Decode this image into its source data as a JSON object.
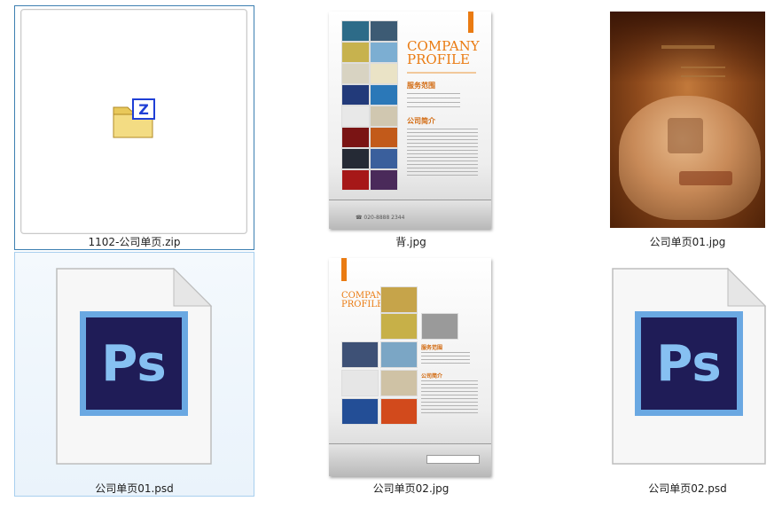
{
  "files": [
    {
      "id": "zip",
      "name": "1102-公司单页.zip",
      "type": "zip",
      "state": "selected",
      "icon": "zip-archive-icon"
    },
    {
      "id": "bg",
      "name": "背.jpg",
      "type": "jpg",
      "state": "normal",
      "preview": {
        "title_line1": "COMPANY",
        "title_line2": "PROFILE",
        "section1": "服务范围",
        "section2": "公司简介",
        "phone": "☎ 020-8888 2344"
      }
    },
    {
      "id": "p01jpg",
      "name": "公司单页01.jpg",
      "type": "jpg",
      "state": "normal"
    },
    {
      "id": "p01psd",
      "name": "公司单页01.psd",
      "type": "psd",
      "state": "hovered",
      "icon": "photoshop-file-icon",
      "icon_text": "Ps"
    },
    {
      "id": "p02jpg",
      "name": "公司单页02.jpg",
      "type": "jpg",
      "state": "normal",
      "preview": {
        "title_line1": "COMPANY",
        "title_line2": "PROFILE",
        "section1": "服务范围",
        "section2": "公司简介"
      }
    },
    {
      "id": "p02psd",
      "name": "公司单页02.psd",
      "type": "psd",
      "state": "normal",
      "icon": "photoshop-file-icon",
      "icon_text": "Ps"
    }
  ],
  "colors": {
    "selection_border": "#3c7fb1",
    "hover_border": "#a8cfee",
    "ps_blue": "#6aa8e2",
    "ps_dark": "#1f1c57",
    "brochure_orange": "#ea7b12"
  }
}
